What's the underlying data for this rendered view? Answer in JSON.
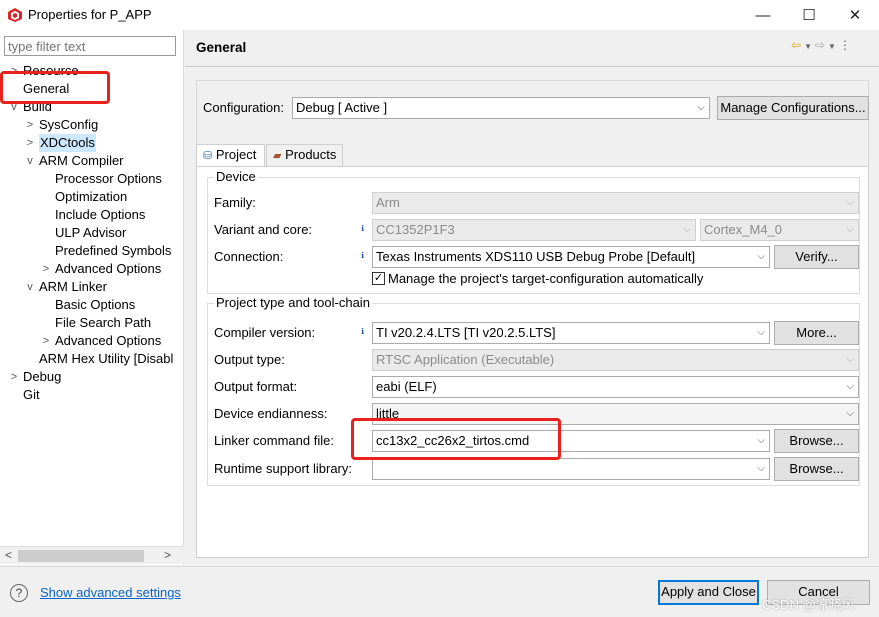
{
  "window": {
    "title": "Properties for P_APP",
    "minimize": "—",
    "maximize": "☐",
    "close": "✕"
  },
  "filter": {
    "placeholder": "type filter text"
  },
  "tree": [
    {
      "label": "Resource",
      "twisty": ">"
    },
    {
      "label": "General",
      "twisty": ""
    },
    {
      "label": "Build",
      "twisty": "v"
    },
    {
      "label": "SysConfig",
      "twisty": ">"
    },
    {
      "label": "XDCtools",
      "twisty": ">"
    },
    {
      "label": "ARM Compiler",
      "twisty": "v"
    },
    {
      "label": "Processor Options",
      "twisty": ""
    },
    {
      "label": "Optimization",
      "twisty": ""
    },
    {
      "label": "Include Options",
      "twisty": ""
    },
    {
      "label": "ULP Advisor",
      "twisty": ""
    },
    {
      "label": "Predefined Symbols",
      "twisty": ""
    },
    {
      "label": "Advanced Options",
      "twisty": ">"
    },
    {
      "label": "ARM Linker",
      "twisty": "v"
    },
    {
      "label": "Basic Options",
      "twisty": ""
    },
    {
      "label": "File Search Path",
      "twisty": ""
    },
    {
      "label": "Advanced Options",
      "twisty": ">"
    },
    {
      "label": "ARM Hex Utility  [Disabl",
      "twisty": ""
    },
    {
      "label": "Debug",
      "twisty": ">"
    },
    {
      "label": "Git",
      "twisty": ""
    }
  ],
  "page": {
    "title": "General"
  },
  "config": {
    "label": "Configuration:",
    "value": "Debug  [ Active ]",
    "manage_button": "Manage Configurations..."
  },
  "tabs": [
    {
      "label": "Project",
      "icon": "project-icon"
    },
    {
      "label": "Products",
      "icon": "products-icon"
    }
  ],
  "device": {
    "group_title": "Device",
    "family_label": "Family:",
    "family_value": "Arm",
    "variant_label": "Variant and core:",
    "variant_value": "CC1352P1F3",
    "core_value": "Cortex_M4_0",
    "connection_label": "Connection:",
    "connection_value": "Texas Instruments XDS110 USB Debug Probe [Default]",
    "verify_button": "Verify...",
    "manage_checkbox_label": "Manage the project's target-configuration automatically",
    "manage_checked": true
  },
  "project": {
    "group_title": "Project type and tool-chain",
    "compiler_label": "Compiler version:",
    "compiler_value": "TI v20.2.4.LTS  [TI v20.2.5.LTS]",
    "more_button": "More...",
    "output_type_label": "Output type:",
    "output_type_value": "RTSC Application (Executable)",
    "output_format_label": "Output format:",
    "output_format_value": "eabi (ELF)",
    "endianness_label": "Device endianness:",
    "endianness_value": "little",
    "linker_label": "Linker command file:",
    "linker_value": "cc13x2_cc26x2_tirtos.cmd",
    "browse_button": "Browse...",
    "runtime_label": "Runtime support library:",
    "runtime_value": "",
    "browse_button_2": "Browse..."
  },
  "footer": {
    "help": "?",
    "advanced_link": "Show advanced settings",
    "apply_close": "Apply and Close",
    "cancel": "Cancel",
    "watermark": "CSDN @凉晓风"
  },
  "colors": {
    "highlight_red": "#e8221c",
    "link_blue": "#0b63c7",
    "focus_blue": "#0078d7"
  }
}
